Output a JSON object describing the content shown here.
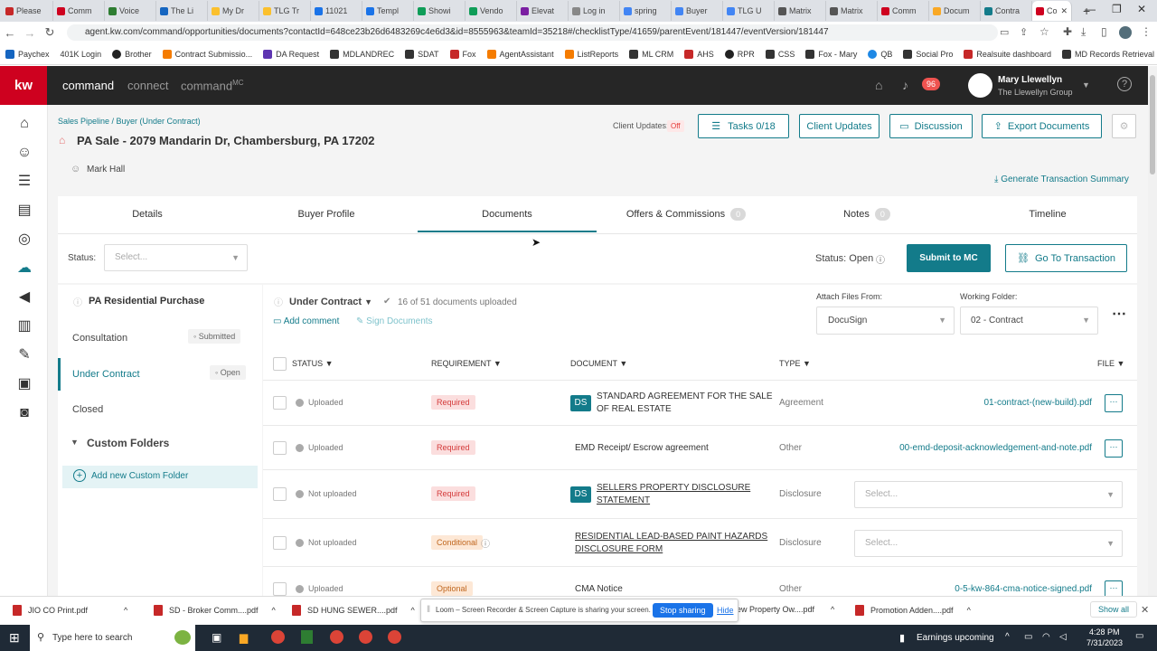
{
  "browser": {
    "tabs": [
      "Please",
      "Comm",
      "Voice",
      "The Li",
      "My Dr",
      "TLG Tr",
      "11021",
      "Templ",
      "Showi",
      "Vendo",
      "Elevat",
      "Log in",
      "spring",
      "Buyer",
      "TLG U",
      "Matrix",
      "Matrix",
      "Comm",
      "Docum",
      "Contra",
      "Co"
    ],
    "url": "agent.kw.com/command/opportunities/documents?contactId=648ce23b26d6483269c4e6d3&id=8555963&teamId=35218#/checklistType/41659/parentEvent/181447/eventVersion/181447",
    "bookmarks": [
      "Paychex",
      "401K Login",
      "Brother",
      "Contract Submissio...",
      "DA Request",
      "MDLANDREC",
      "SDAT",
      "Fox",
      "AgentAssistant",
      "ListReports",
      "ML CRM",
      "AHS",
      "RPR",
      "CSS",
      "Fox - Mary",
      "QB",
      "Social Pro",
      "Realsuite dashboard",
      "MD Records Retrieval"
    ]
  },
  "header": {
    "logo": "kw",
    "nav": [
      "command",
      "connect",
      "command"
    ],
    "nav_superscript": "MC",
    "notif_count": "96",
    "user_name": "Mary Llewellyn",
    "user_team": "The Llewellyn Group"
  },
  "page": {
    "breadcrumb": "Sales Pipeline / Buyer (Under Contract)",
    "title": "PA Sale - 2079 Mandarin Dr, Chambersburg, PA 17202",
    "contact": "Mark Hall",
    "client_updates_label": "Client Updates:",
    "client_updates_state": "Off",
    "buttons": {
      "tasks": "Tasks 0/18",
      "client_updates": "Client Updates",
      "discussion": "Discussion",
      "export": "Export Documents"
    },
    "generate_summary": "Generate Transaction Summary"
  },
  "tabs": [
    {
      "label": "Details"
    },
    {
      "label": "Buyer Profile"
    },
    {
      "label": "Documents"
    },
    {
      "label": "Offers & Commissions",
      "badge": "0"
    },
    {
      "label": "Notes",
      "badge": "0"
    },
    {
      "label": "Timeline"
    }
  ],
  "status_bar": {
    "status_label": "Status:",
    "status_placeholder": "Select...",
    "status_open": "Status: Open",
    "submit_mc": "Submit to MC",
    "go_transaction": "Go To Transaction"
  },
  "checklist": {
    "name": "PA Residential Purchase",
    "stages": [
      {
        "label": "Consultation",
        "state": "Submitted"
      },
      {
        "label": "Under Contract",
        "state": "Open"
      },
      {
        "label": "Closed",
        "state": ""
      }
    ],
    "custom_folders": "Custom Folders",
    "add_folder": "Add new Custom Folder"
  },
  "documents": {
    "stage": "Under Contract",
    "uploaded_count": "16 of 51 documents uploaded",
    "add_comment": "Add comment",
    "sign_documents": "Sign Documents",
    "attach_label": "Attach Files From:",
    "attach_value": "DocuSign",
    "folder_label": "Working Folder:",
    "folder_value": "02 - Contract",
    "columns": [
      "STATUS",
      "REQUIREMENT",
      "DOCUMENT",
      "TYPE",
      "FILE"
    ],
    "rows": [
      {
        "status": "Uploaded",
        "requirement": "Required",
        "ds": true,
        "document": "STANDARD AGREEMENT FOR THE SALE OF REAL ESTATE",
        "type": "Agreement",
        "file": "01-contract-(new-build).pdf"
      },
      {
        "status": "Uploaded",
        "requirement": "Required",
        "ds": false,
        "document": "EMD Receipt/ Escrow agreement",
        "type": "Other",
        "file": "00-emd-deposit-acknowledgement-and-note.pdf"
      },
      {
        "status": "Not uploaded",
        "requirement": "Required",
        "ds": true,
        "document": "SELLERS PROPERTY DISCLOSURE STATEMENT",
        "type": "Disclosure",
        "file": "Select..."
      },
      {
        "status": "Not uploaded",
        "requirement": "Conditional",
        "ds": false,
        "document": "RESIDENTIAL LEAD-BASED PAINT HAZARDS DISCLOSURE FORM",
        "type": "Disclosure",
        "file": "Select..."
      },
      {
        "status": "Uploaded",
        "requirement": "Optional",
        "ds": false,
        "document": "CMA Notice",
        "type": "Other",
        "file": "0-5-kw-864-cma-notice-signed.pdf"
      }
    ]
  },
  "downloads": [
    "JIO CO Print.pdf",
    "SD - Broker Comm....pdf",
    "SD HUNG SEWER....pdf",
    "ew Property Ow....pdf",
    "Promotion Adden....pdf"
  ],
  "show_all": "Show all",
  "loom": {
    "text": "Loom – Screen Recorder & Screen Capture is sharing your screen.",
    "stop": "Stop sharing",
    "hide": "Hide"
  },
  "taskbar": {
    "search": "Type here to search",
    "weather": "Earnings upcoming",
    "time": "4:28 PM",
    "date": "7/31/2023"
  }
}
